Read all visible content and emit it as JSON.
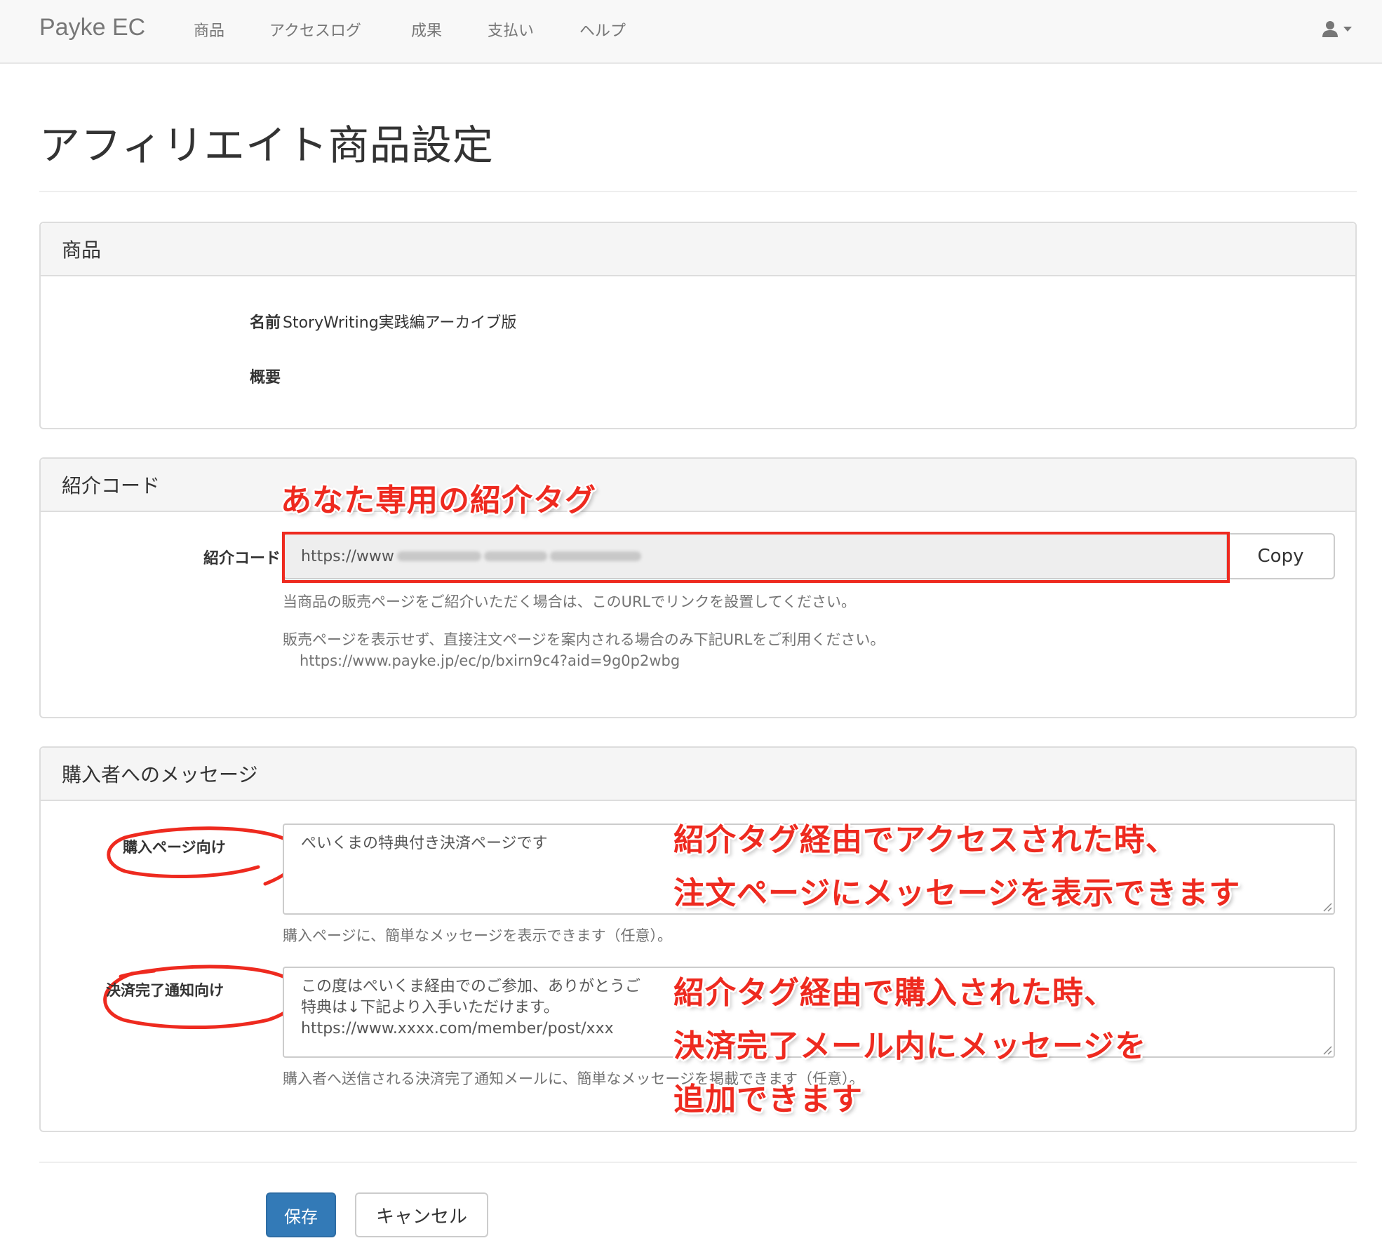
{
  "navbar": {
    "brand": "Payke EC",
    "items": [
      "商品",
      "アクセスログ",
      "成果",
      "支払い",
      "ヘルプ"
    ],
    "user_icon": "user-icon",
    "caret_icon": "caret-down-icon"
  },
  "page_title": "アフィリエイト商品設定",
  "product_panel": {
    "heading": "商品",
    "name_label": "名前",
    "name_value": "StoryWriting実践編アーカイブ版",
    "summary_label": "概要",
    "summary_value": ""
  },
  "referral_panel": {
    "heading": "紹介コード",
    "label": "紹介コード",
    "url_value": "https://www",
    "copy_label": "Copy",
    "help1": "当商品の販売ページをご紹介いただく場合は、このURLでリンクを設置してください。",
    "help2": "販売ページを表示せず、直接注文ページを案内される場合のみ下記URLをご利用ください。",
    "direct_url": "https://www.payke.jp/ec/p/bxirn9c4?aid=9g0p2wbg"
  },
  "message_panel": {
    "heading": "購入者へのメッセージ",
    "purchase_label": "購入ページ向け",
    "purchase_value": "ぺいくまの特典付き決済ページです",
    "purchase_help": "購入ページに、簡単なメッセージを表示できます（任意）。",
    "complete_label": "決済完了通知向け",
    "complete_lines": [
      "この度はぺいくま経由でのご参加、ありがとうご",
      "特典は↓下記より入手いただけます。",
      "https://www.xxxx.com/member/post/xxx"
    ],
    "complete_help": "購入者へ送信される決済完了通知メールに、簡単なメッセージを掲載できます（任意）。"
  },
  "annotations": {
    "tag_note": "あなた専用の紹介タグ",
    "access_note_1": "紹介タグ経由でアクセスされた時、",
    "access_note_2": "注文ページにメッセージを表示できます",
    "purchase_note_1": "紹介タグ経由で購入された時、",
    "purchase_note_2": "決済完了メール内にメッセージを",
    "purchase_note_3": "追加できます",
    "accent_color": "#ee2a1f"
  },
  "buttons": {
    "save": "保存",
    "cancel": "キャンセル"
  }
}
